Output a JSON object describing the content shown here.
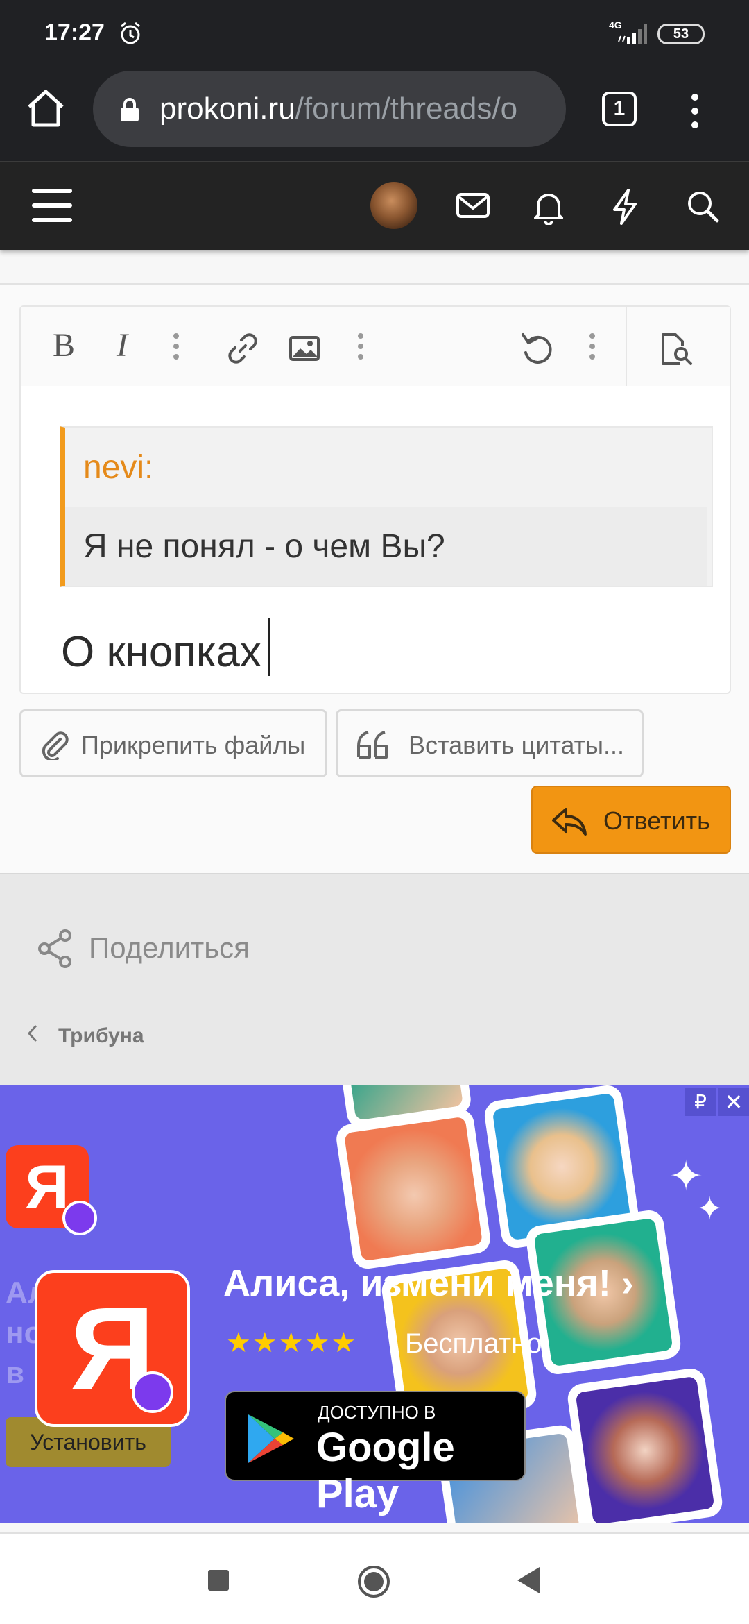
{
  "status_bar": {
    "time": "17:27",
    "network": "4G",
    "battery": "53"
  },
  "browser": {
    "url_domain": "prokoni.ru",
    "url_path": "/forum/threads/o",
    "tab_count": "1"
  },
  "editor": {
    "quote_author": "nevi:",
    "quote_text": "Я не понял - о чем Вы?",
    "typed_text": "О кнопках",
    "toolbar": {
      "bold": "B",
      "italic": "I"
    }
  },
  "actions": {
    "attach_label": "Прикрепить файлы",
    "insert_quotes_label": "Вставить цитаты...",
    "reply_label": "Ответить"
  },
  "share": {
    "label": "Поделиться"
  },
  "breadcrumb": {
    "label": "Трибуна"
  },
  "ad": {
    "currency_badge": "₽",
    "close_badge": "✕",
    "logo_letter": "Я",
    "title": "Алиса, измени меня! ›",
    "rating": 4.5,
    "stars": "★★★★★",
    "price": "Бесплатно",
    "background_text_line1": "Ал",
    "background_text_line2": "но",
    "background_text_line3": "в",
    "install_label": "Установить",
    "store_badge_small": "ДОСТУПНО В",
    "store_badge_big": "Google Play"
  },
  "colors": {
    "accent_orange": "#f29512",
    "quote_author": "#e58a1a",
    "ad_background": "#6a63e9",
    "yandex_red": "#fc3f1d"
  }
}
